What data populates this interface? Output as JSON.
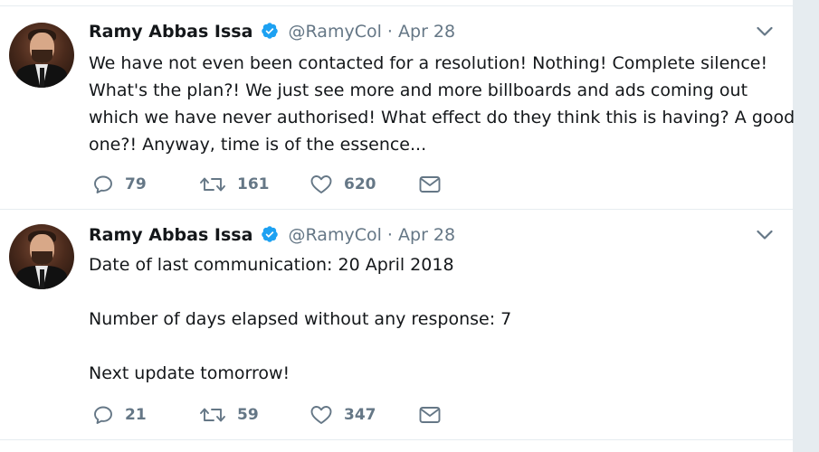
{
  "colors": {
    "page_bg": "#e6ecf0",
    "card_bg": "#ffffff",
    "text": "#14171a",
    "muted": "#657786",
    "verified": "#1da1f2",
    "icon": "#657786"
  },
  "tweets": [
    {
      "author_name": "Ramy Abbas Issa",
      "handle": "@RamyCol",
      "separator": "·",
      "date": "Apr 28",
      "verified": true,
      "text_lines": [
        "We have not even been contacted for a resolution! Nothing! Complete silence!",
        "What's the plan?! We just see more and more billboards and ads coming out",
        "which we have never authorised! What effect do they think this is having? A good",
        "one?! Anyway, time is of the essence..."
      ],
      "replies": "79",
      "retweets": "161",
      "likes": "620",
      "icons": [
        "reply-icon",
        "retweet-icon",
        "like-icon",
        "message-icon",
        "chevron-down-icon",
        "verified-badge-icon"
      ]
    },
    {
      "author_name": "Ramy Abbas Issa",
      "handle": "@RamyCol",
      "separator": "·",
      "date": "Apr 28",
      "verified": true,
      "text_lines": [
        "Date of last communication: 20 April 2018",
        "",
        "Number of days elapsed without any response: 7",
        "",
        "Next update tomorrow!"
      ],
      "replies": "21",
      "retweets": "59",
      "likes": "347",
      "icons": [
        "reply-icon",
        "retweet-icon",
        "like-icon",
        "message-icon",
        "chevron-down-icon",
        "verified-badge-icon"
      ]
    }
  ]
}
